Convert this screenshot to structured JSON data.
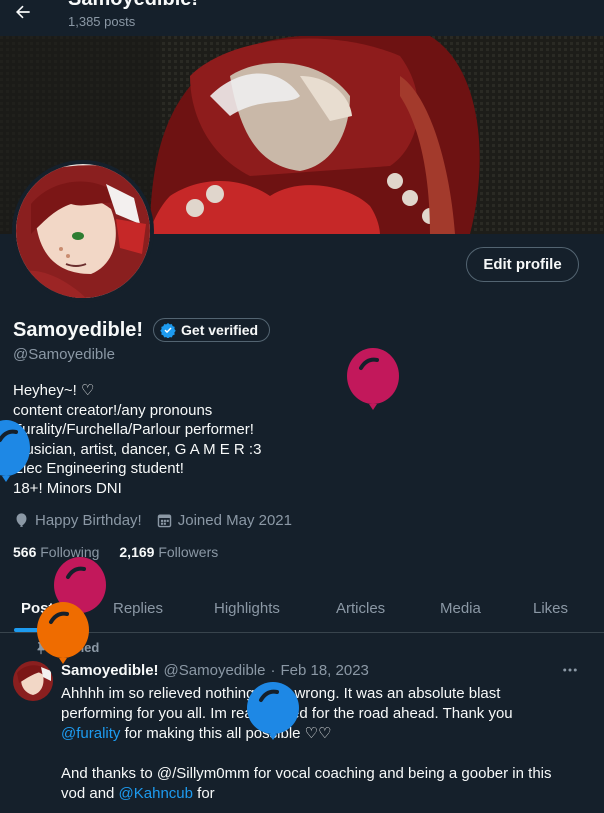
{
  "header": {
    "title": "Samoyedible!",
    "post_count": "1,385 posts"
  },
  "profile": {
    "display_name": "Samoyedible!",
    "get_verified_label": "Get verified",
    "handle": "@Samoyedible",
    "edit_profile_label": "Edit profile",
    "bio_lines": [
      "Heyhey~! ♡",
      "content creator!/any pronouns",
      "Furality/Furchella/Parlour performer!",
      "Musician, artist, dancer, G A M E R :3",
      "Elec Engineering student!",
      "18+! Minors DNI"
    ],
    "birthday": "Happy Birthday!",
    "joined": "Joined May 2021",
    "following_count": "566",
    "following_label": "Following",
    "followers_count": "2,169",
    "followers_label": "Followers"
  },
  "tabs": [
    "Posts",
    "Replies",
    "Highlights",
    "Articles",
    "Media",
    "Likes"
  ],
  "pinned_post": {
    "pinned_label": "Pinned",
    "author_name": "Samoyedible!",
    "author_handle": "@Samoyedible",
    "separator": "·",
    "date": "Feb 18, 2023",
    "line1": "Ahhhh im so relieved nothing went wrong. It was an absolute blast",
    "line2": "performing for you all. Im real excited for the road ahead. Thank you",
    "mention1": "@furality",
    "line3_rest": " for making this all possible ♡♡",
    "line4": "And thanks to @/Sillym0mm for vocal coaching and being a goober in this",
    "line5_start": "vod and ",
    "mention2": "@Kahncub",
    "line5_end": " for"
  },
  "icons": {
    "back": "back-arrow-icon",
    "verified": "verified-badge-icon",
    "birthday": "balloon-icon",
    "calendar": "calendar-icon",
    "pin": "pin-icon",
    "more": "more-dots-icon"
  },
  "colors": {
    "background": "#15202b",
    "accent": "#1d9bf0",
    "muted_text": "#8b98a5",
    "balloon_pink": "#c2185b",
    "balloon_blue": "#1e88e5",
    "balloon_orange": "#ef6c00"
  }
}
